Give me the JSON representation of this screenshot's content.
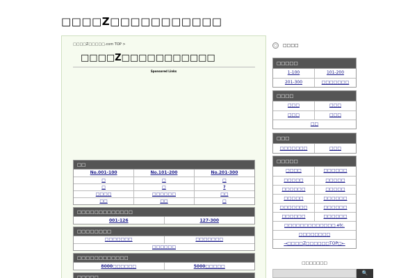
{
  "site": {
    "title": "□□□□Z□□□□□□□□□□□"
  },
  "main": {
    "breadcrumb": "□□□□Z□□□□□.com TOP >",
    "title": "□□□□Z□□□□□□□□□□□",
    "sponsored": "Sponsored Links",
    "panels": [
      {
        "header": "□□",
        "rows": [
          [
            "No.001-100",
            "No.101-200",
            "No.201-300"
          ],
          [
            "□",
            "□",
            "□"
          ],
          [
            "□",
            "□",
            "?"
          ],
          [
            "□□□□",
            "□□□□□□",
            "□□"
          ],
          [
            "□□",
            "□□",
            "□"
          ]
        ]
      },
      {
        "header": "□□□□□□□□□□□□□",
        "rows": [
          [
            "001-126",
            "127-300"
          ]
        ]
      },
      {
        "header": "□□□□□□□□",
        "rows": [
          [
            "□□□□□□□",
            "□□□□□□□"
          ],
          [
            "□□□□□□"
          ]
        ]
      },
      {
        "header": "□□□□□□□□□□□□",
        "rows": [
          [
            "8000□□□□□□",
            "5000□□□□□"
          ]
        ]
      },
      {
        "header": "□□□□□",
        "rows": []
      }
    ]
  },
  "sidebar": {
    "search_label": "□□□□",
    "search_icon": "magnifier-icon",
    "boxes": [
      {
        "header": "□□□□□",
        "rows": [
          [
            "1-100",
            "101-200"
          ],
          [
            "201-300",
            "□□□□□□□"
          ]
        ]
      },
      {
        "header": "□□□□",
        "rows": [
          [
            "□□□",
            "□□□"
          ],
          [
            "□□□",
            "□□□"
          ],
          [
            "□□"
          ]
        ]
      },
      {
        "header": "□□□",
        "rows": [
          [
            "□□□□□□□",
            "□□□"
          ]
        ]
      },
      {
        "header": "□□□□□",
        "rows": [
          [
            "□□□□",
            "□□□□□□"
          ],
          [
            "□□□□□",
            "□□□□□"
          ],
          [
            "□□□□□□",
            "□□□□□"
          ],
          [
            "□□□□□",
            "□□□□□□"
          ],
          [
            "□□□□□□□",
            "□□□□□□"
          ],
          [
            "□□□□□□",
            "□□□□□□"
          ],
          [
            "□□□□□□□□□□□□□.etc."
          ],
          [
            "□□□□□□□□"
          ],
          [
            "→□□□□Z□□□□□□TOP□←"
          ]
        ]
      }
    ],
    "bottom_label": "□□□□□□□",
    "colors": {
      "header_bg": "#555555",
      "main_bg": "#f6fbef",
      "link": "#1a1a8a"
    }
  }
}
